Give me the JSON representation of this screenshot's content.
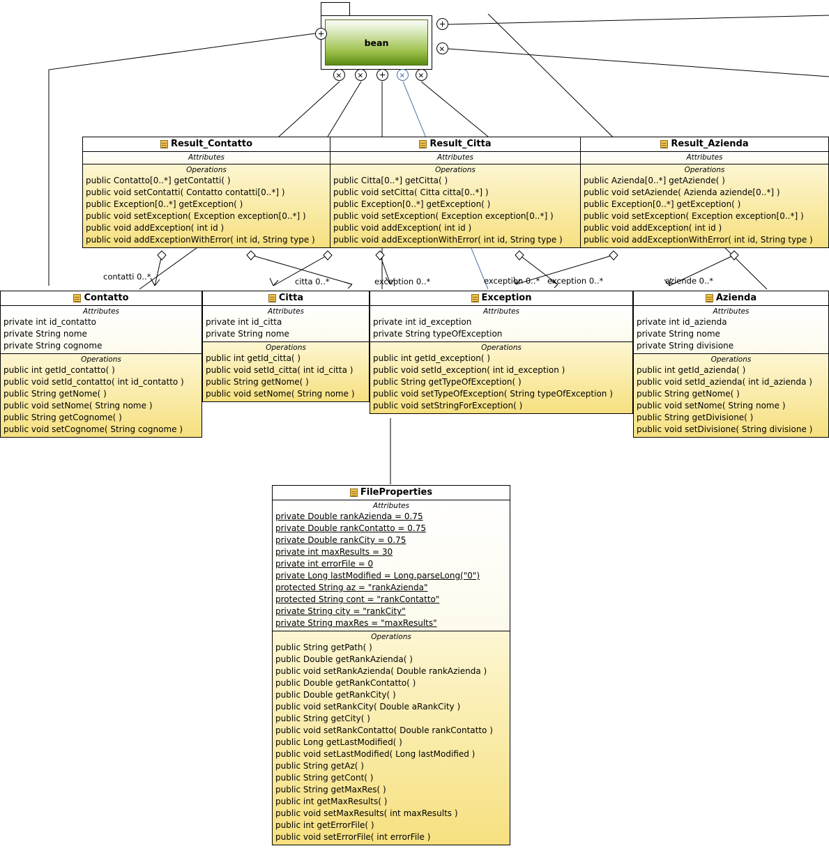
{
  "diagram": {
    "type": "uml-class-diagram",
    "package": {
      "name": "bean",
      "interfaces": [
        {
          "glyph": "x",
          "color": "#000000"
        },
        {
          "glyph": "+",
          "color": "#000000"
        },
        {
          "glyph": "x",
          "color": "#000000"
        },
        {
          "glyph": "x",
          "color": "#000000"
        },
        {
          "glyph": "x",
          "color": "#000000"
        },
        {
          "glyph": "+",
          "color": "#000000"
        },
        {
          "glyph": "x",
          "color": "#4a6fa5"
        },
        {
          "glyph": "x",
          "color": "#000000"
        }
      ]
    },
    "section_headings": {
      "attributes": "Attributes",
      "operations": "Operations"
    },
    "classes": [
      {
        "id": "result_contatto",
        "name": "Result_Contatto",
        "attributes": [],
        "operations": [
          "public Contatto[0..*]  getContatti(  )",
          "public void  setContatti( Contatto contatti[0..*] )",
          "public Exception[0..*]  getException(  )",
          "public void  setException( Exception exception[0..*] )",
          "public void  addException( int id )",
          "public void  addExceptionWithError( int id, String type )"
        ]
      },
      {
        "id": "result_citta",
        "name": "Result_Citta",
        "attributes": [],
        "operations": [
          "public Citta[0..*]  getCitta(  )",
          "public void  setCitta( Citta citta[0..*] )",
          "public Exception[0..*]  getException(  )",
          "public void  setException( Exception exception[0..*] )",
          "public void  addException( int id )",
          "public void  addExceptionWithError( int id, String type )"
        ]
      },
      {
        "id": "result_azienda",
        "name": "Result_Azienda",
        "attributes": [],
        "operations": [
          "public Azienda[0..*]  getAziende(  )",
          "public void  setAziende( Azienda aziende[0..*] )",
          "public Exception[0..*]  getException(  )",
          "public void  setException( Exception exception[0..*] )",
          "public void  addException( int id )",
          "public void  addExceptionWithError( int id, String type )"
        ]
      },
      {
        "id": "contatto",
        "name": "Contatto",
        "attributes": [
          "private int id_contatto",
          "private String nome",
          "private String cognome"
        ],
        "operations": [
          "public int  getId_contatto(  )",
          "public void  setId_contatto( int id_contatto )",
          "public String  getNome(  )",
          "public void  setNome( String nome )",
          "public String  getCognome(  )",
          "public void  setCognome( String cognome )"
        ]
      },
      {
        "id": "citta",
        "name": "Citta",
        "attributes": [
          "private int id_citta",
          "private String nome"
        ],
        "operations": [
          "public int  getId_citta(  )",
          "public void  setId_citta( int id_citta )",
          "public String  getNome(  )",
          "public void  setNome( String nome )"
        ]
      },
      {
        "id": "exception",
        "name": "Exception",
        "attributes": [
          "private int id_exception",
          "private String typeOfException"
        ],
        "operations": [
          "public int  getId_exception(  )",
          "public void  setId_exception( int id_exception )",
          "public String  getTypeOfException(  )",
          "public void  setTypeOfException( String typeOfException )",
          "public void  setStringForException(  )"
        ]
      },
      {
        "id": "azienda",
        "name": "Azienda",
        "attributes": [
          "private int id_azienda",
          "private String nome",
          "private String divisione"
        ],
        "operations": [
          "public int  getId_azienda(  )",
          "public void  setId_azienda( int id_azienda )",
          "public String  getNome(  )",
          "public void  setNome( String nome )",
          "public String  getDivisione(  )",
          "public void  setDivisione( String divisione )"
        ]
      },
      {
        "id": "fileproperties",
        "name": "FileProperties",
        "attributes": [
          "private Double rankAzienda = 0.75",
          "private Double rankContatto = 0.75",
          "private Double rankCity = 0.75",
          "private int maxResults = 30",
          "private int errorFile = 0",
          "private Long lastModified = Long.parseLong(\"0\")",
          "protected String az = \"rankAzienda\"",
          "protected String cont = \"rankContatto\"",
          "private String city = \"rankCity\"",
          "private String maxRes = \"maxResults\""
        ],
        "attributes_static": true,
        "operations": [
          "public String  getPath(  )",
          "public Double  getRankAzienda(  )",
          "public void  setRankAzienda( Double rankAzienda )",
          "public Double  getRankContatto(  )",
          "public Double  getRankCity(  )",
          "public void  setRankCity( Double aRankCity )",
          "public String  getCity(  )",
          "public void  setRankContatto( Double rankContatto )",
          "public Long  getLastModified(  )",
          "public void  setLastModified( Long lastModified )",
          "public String  getAz(  )",
          "public String  getCont(  )",
          "public String  getMaxRes(  )",
          "public int  getMaxResults(  )",
          "public void  setMaxResults( int maxResults )",
          "public int  getErrorFile(  )",
          "public void  setErrorFile( int errorFile )"
        ]
      }
    ],
    "associations": [
      {
        "label": "contatti 0..*",
        "from": "result_contatto",
        "to": "contatto"
      },
      {
        "label": "citta 0..*",
        "from": "result_citta",
        "to": "citta"
      },
      {
        "label": "exception 0..*",
        "from": "result_contatto",
        "to": "exception"
      },
      {
        "label": "exception 0..*",
        "from": "result_citta",
        "to": "exception"
      },
      {
        "label": "exception 0..*",
        "from": "result_azienda",
        "to": "exception"
      },
      {
        "label": "aziende 0..*",
        "from": "result_azienda",
        "to": "azienda"
      }
    ]
  }
}
